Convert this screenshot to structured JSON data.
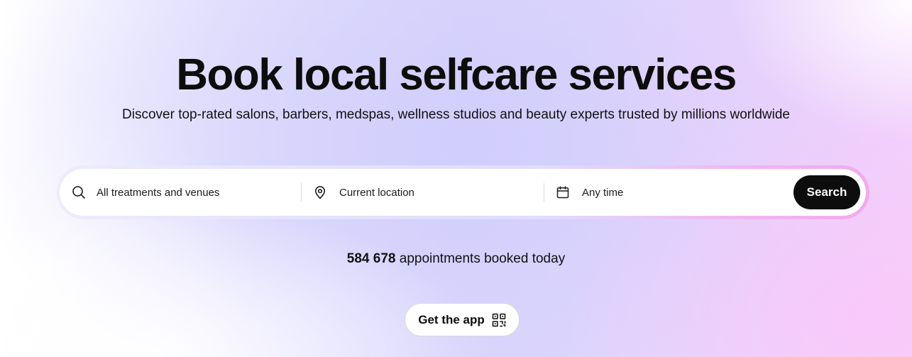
{
  "hero": {
    "title": "Book local selfcare services",
    "subtitle": "Discover top-rated salons, barbers, medspas, wellness studios and beauty experts trusted by millions worldwide"
  },
  "search": {
    "treatments_label": "All treatments and venues",
    "location_label": "Current location",
    "time_label": "Any time",
    "button_label": "Search",
    "icons": {
      "treatments": "search-icon",
      "location": "map-pin-icon",
      "time": "calendar-icon"
    }
  },
  "stats": {
    "count": "584 678",
    "suffix": " appointments booked today"
  },
  "app_promo": {
    "label": "Get the app",
    "icon": "qr-code-icon"
  },
  "colors": {
    "primary_button": "#0d0d0d",
    "button_text": "#ffffff",
    "gradient_lavender": "#d9d6fc",
    "gradient_pink": "#f7d2fb"
  }
}
